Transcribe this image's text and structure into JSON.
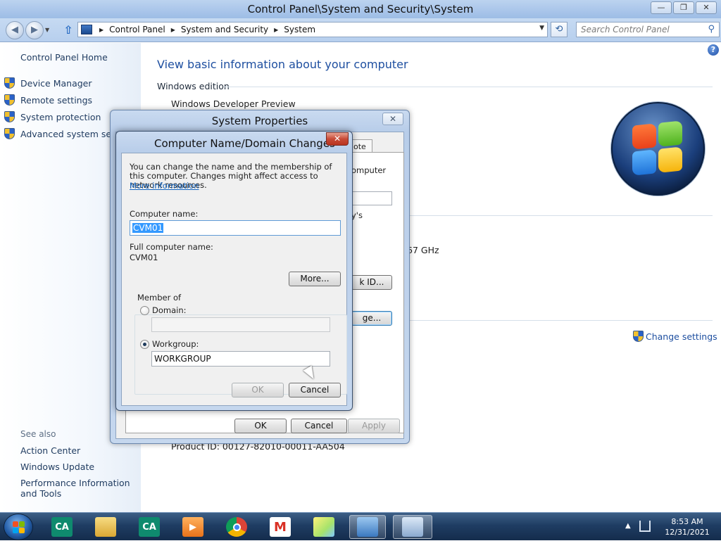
{
  "window": {
    "title": "Control Panel\\System and Security\\System",
    "minimize_glyph": "—",
    "restore_glyph": "❐",
    "close_glyph": "✕"
  },
  "nav": {
    "back_glyph": "◀",
    "forward_glyph": "▶",
    "breadcrumbs": [
      "Control Panel",
      "System and Security",
      "System"
    ],
    "search_placeholder": "Search Control Panel"
  },
  "sidebar": {
    "home": "Control Panel Home",
    "items": [
      {
        "label": "Device Manager",
        "icon": "shield-icon"
      },
      {
        "label": "Remote settings",
        "icon": "shield-icon"
      },
      {
        "label": "System protection",
        "icon": "shield-icon"
      },
      {
        "label": "Advanced system settings",
        "icon": "shield-icon"
      }
    ],
    "see_also": "See also",
    "links": [
      "Action Center",
      "Windows Update",
      "Performance Information and Tools"
    ]
  },
  "main": {
    "title": "View basic information about your computer",
    "windows_edition_heading": "Windows edition",
    "edition": "Windows Developer Preview",
    "processor_fragment": "67 GHz",
    "change_settings": "Change settings",
    "product_id": "Product ID: 00127-82010-00011-AA504"
  },
  "system_properties": {
    "title": "System Properties",
    "visible_tab_fragment": "ote",
    "fragments": [
      "omputer",
      "y's"
    ],
    "network_id_button_fragment": "k ID...",
    "change_button_fragment": "ge...",
    "ok": "OK",
    "cancel": "Cancel",
    "apply": "Apply"
  },
  "computer_name_dialog": {
    "title": "Computer Name/Domain Changes",
    "description": "You can change the name and the membership of this computer. Changes might affect access to network resources.",
    "more_information": "More information",
    "computer_name_label": "Computer name:",
    "computer_name_value": "CVM01",
    "full_name_label": "Full computer name:",
    "full_name_value": "CVM01",
    "more_button": "More...",
    "member_of": "Member of",
    "domain_label": "Domain:",
    "domain_value": "",
    "workgroup_label": "Workgroup:",
    "workgroup_value": "WORKGROUP",
    "selected_membership": "Workgroup",
    "ok": "OK",
    "cancel": "Cancel"
  },
  "taskbar": {
    "pinned": [
      {
        "name": "credit-agricole-icon",
        "glyph": "CA"
      },
      {
        "name": "file-explorer-icon",
        "glyph": ""
      },
      {
        "name": "credit-agricole-icon",
        "glyph": "CA"
      },
      {
        "name": "media-player-icon",
        "glyph": "▶"
      },
      {
        "name": "chrome-icon",
        "glyph": ""
      },
      {
        "name": "gmail-icon",
        "glyph": "M"
      },
      {
        "name": "sticky-notes-icon",
        "glyph": ""
      },
      {
        "name": "remote-desktop-icon",
        "glyph": ""
      },
      {
        "name": "control-panel-icon",
        "glyph": ""
      }
    ],
    "time": "8:53 AM",
    "date": "12/31/2021"
  }
}
